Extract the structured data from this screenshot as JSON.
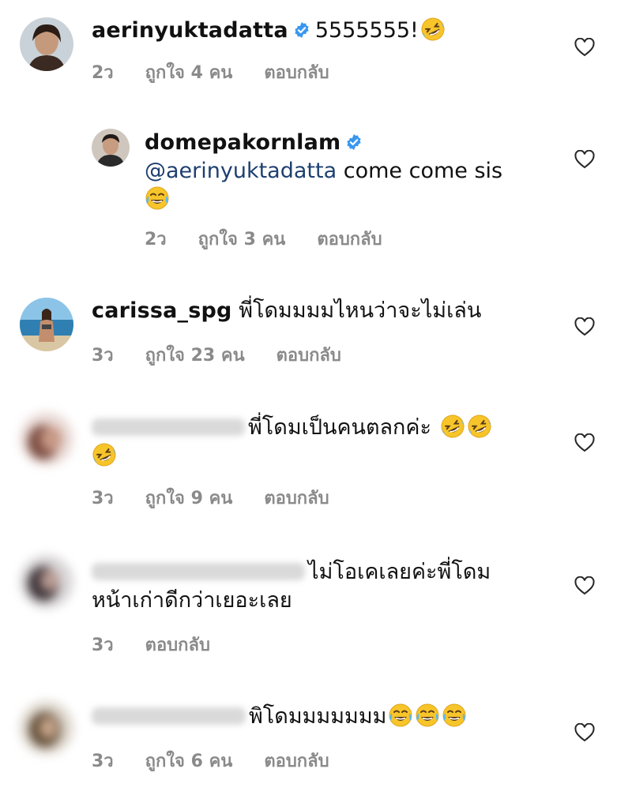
{
  "comments": [
    {
      "username": "aerinyuktadatta",
      "text": "5555555!",
      "time": "2ว",
      "likes": "ถูกใจ 4 คน",
      "reply": "ตอบกลับ"
    },
    {
      "username": "domepakornlam",
      "mention": "@aerinyuktadatta",
      "text": "come come sis",
      "time": "2ว",
      "likes": "ถูกใจ 3 คน",
      "reply": "ตอบกลับ"
    },
    {
      "username": "carissa_spg",
      "text": "พี่โดมมมมไหนว่าจะไม่เล่น",
      "time": "3ว",
      "likes": "ถูกใจ 23 คน",
      "reply": "ตอบกลับ"
    },
    {
      "text": "พี่โดมเป็นคนตลกค่ะ",
      "time": "3ว",
      "likes": "ถูกใจ 9 คน",
      "reply": "ตอบกลับ"
    },
    {
      "text_line1": "ไม่โอเคเลยค่ะพี่โดม",
      "text_line2": "หน้าเก่าดีกว่าเยอะเลย",
      "time": "3ว",
      "reply": "ตอบกลับ"
    },
    {
      "text": "พิโดมมมมมมม",
      "time": "3ว",
      "likes": "ถูกใจ 6 คน",
      "reply": "ตอบกลับ"
    }
  ],
  "icons": {
    "verified": "verified-badge-icon",
    "like": "heart-icon",
    "rofl": "rolling-on-floor-laughing-emoji",
    "tears_of_joy": "face-with-tears-of-joy-emoji"
  },
  "colors": {
    "verified": "#3897f0",
    "meta": "#8a8a8a",
    "mention": "#1e3f70"
  }
}
